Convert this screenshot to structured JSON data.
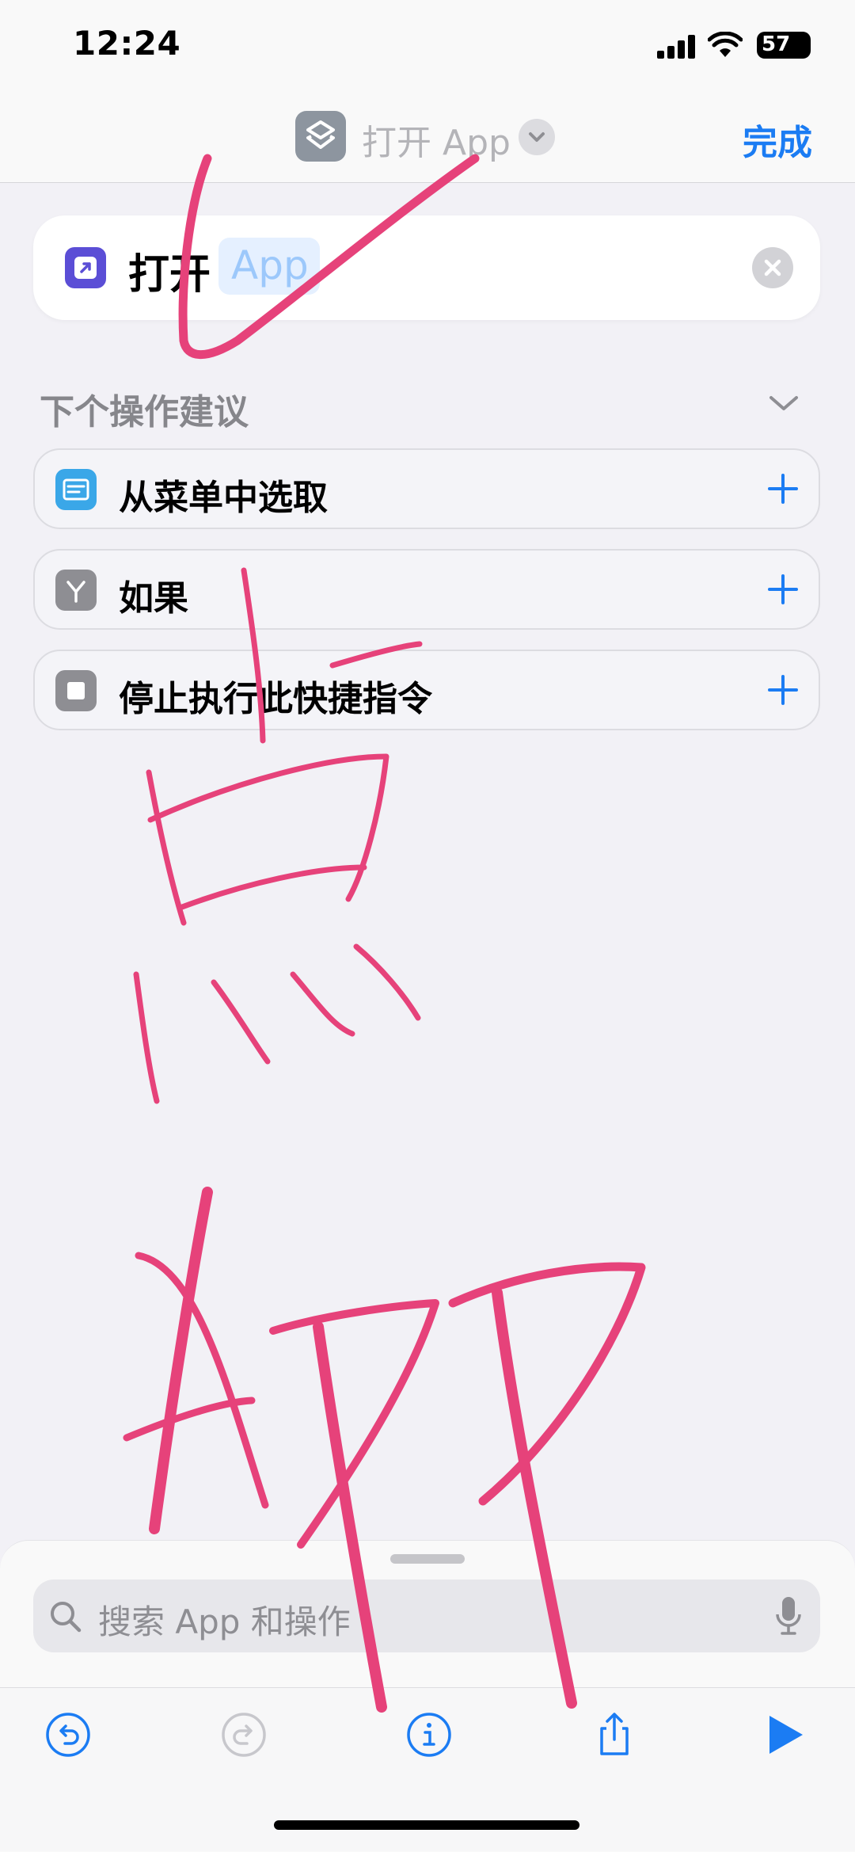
{
  "status_bar": {
    "time": "12:24",
    "battery": "57"
  },
  "header": {
    "title": "打开 App",
    "done_label": "完成"
  },
  "action": {
    "verb": "打开",
    "app_placeholder": "App"
  },
  "suggestions": {
    "title": "下个操作建议",
    "items": [
      {
        "label": "从菜单中选取",
        "icon": "menu-icon",
        "icon_color": "#3aa7e8"
      },
      {
        "label": "如果",
        "icon": "branch-icon",
        "icon_color": "#8e8e93"
      },
      {
        "label": "停止执行此快捷指令",
        "icon": "stop-icon",
        "icon_color": "#8e8e93"
      }
    ]
  },
  "search": {
    "placeholder": "搜索 App 和操作"
  },
  "colors": {
    "accent": "#1b7cf3",
    "ink": "#e6427a",
    "background": "#f2f1f6"
  }
}
